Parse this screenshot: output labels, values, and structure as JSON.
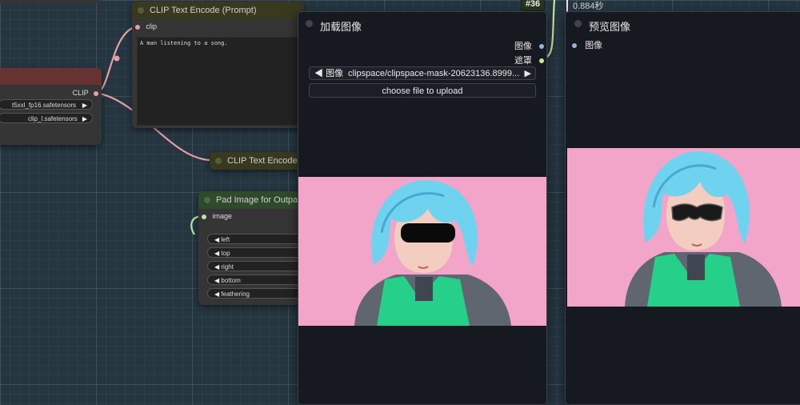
{
  "badge": "#36",
  "time_label": "0.884秒",
  "clip_text_node": {
    "title": "CLIP Text Encode (Prompt)",
    "input_label": "clip",
    "prompt_text": "A man listening to a song."
  },
  "loader_node": {
    "output_label": "CLIP",
    "widget1": "t5xxl_fp16.safetensors",
    "widget2": "clip_l.safetensors"
  },
  "clip_text_node2": {
    "title": "CLIP Text Encode ("
  },
  "pad_node": {
    "title": "Pad Image for Outpain",
    "input_label": "image",
    "widgets": [
      "left",
      "top",
      "right",
      "bottom",
      "feathering"
    ]
  },
  "load_image": {
    "title": "加载图像",
    "out_image": "图像",
    "out_mask": "遮罩",
    "combo_label": "图像",
    "combo_value": "clipspace/clipspace-mask-20623136.8999...",
    "upload_label": "choose file to upload"
  },
  "preview": {
    "title": "预览图像",
    "input_label": "图像"
  },
  "colors": {
    "canvas_bg": "#253641",
    "node_bg": "#353535",
    "panel_bg": "#16191f",
    "pink_bg": "#f2a5c9",
    "clip_link": "#e7a0a8",
    "image_link": "#b6e3a5",
    "mask_link": "#c9e89b",
    "badge_bg": "#27361f"
  },
  "icons": [
    "left-arrow-icon",
    "right-arrow-icon",
    "node-collapse-dot-icon",
    "slot-dot-icon"
  ]
}
